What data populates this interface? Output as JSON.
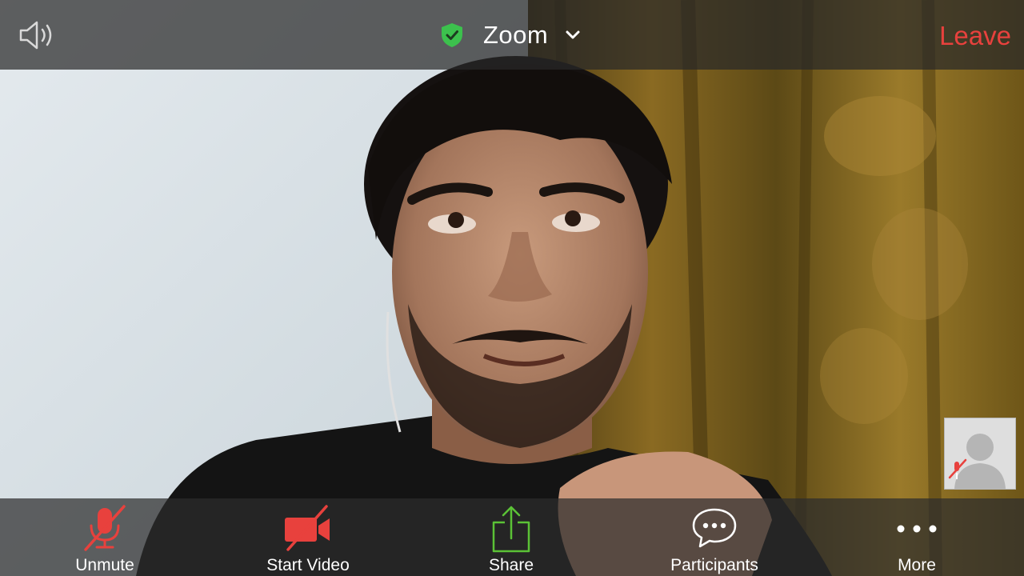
{
  "top_bar": {
    "title": "Zoom",
    "leave_label": "Leave",
    "speaker_icon": "speaker-icon",
    "shield_icon": "shield-check-icon",
    "chevron_icon": "chevron-down-icon"
  },
  "toolbar": {
    "buttons": [
      {
        "label": "Unmute",
        "icon": "microphone-muted-icon"
      },
      {
        "label": "Start Video",
        "icon": "video-off-icon"
      },
      {
        "label": "Share",
        "icon": "share-icon"
      },
      {
        "label": "Participants",
        "icon": "chat-bubble-icon"
      },
      {
        "label": "More",
        "icon": "more-dots-icon"
      }
    ]
  },
  "colors": {
    "leave": "#e8413d",
    "muted_red": "#e8413d",
    "share_green": "#5bc236",
    "shield_green": "#3cc14d",
    "bar_background": "#2d2d2d"
  }
}
